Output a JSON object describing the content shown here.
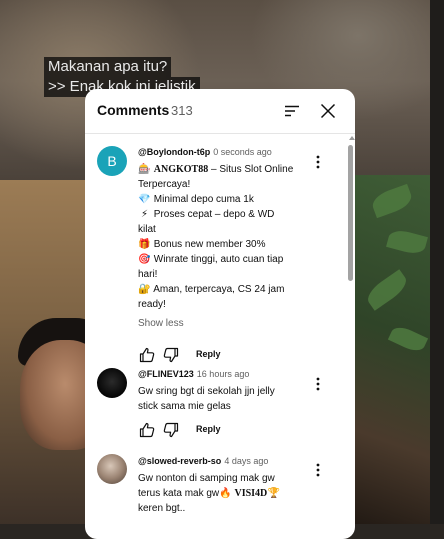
{
  "captions": [
    "Makanan apa itu?",
    ">> Enak kok ini jelistik"
  ],
  "panel": {
    "title": "Comments",
    "count": "313",
    "sort_icon": "sort-icon",
    "close_icon": "close-icon"
  },
  "comments": [
    {
      "handle": "@Boylondon-t6p",
      "time": "0 seconds ago",
      "avatar_letter": "B",
      "avatar_color": "#1aa3b8",
      "lines": [
        {
          "emoji": "🎰",
          "brand": "ANGKOT88",
          "text": " – Situs Slot Online"
        },
        {
          "emoji": "",
          "brand": "",
          "text": "Terpercaya!"
        },
        {
          "emoji": "💎",
          "brand": "",
          "text": " Minimal depo cuma 1k"
        },
        {
          "emoji": "⚡",
          "brand": "",
          "text": " Proses cepat – depo & WD"
        },
        {
          "emoji": "",
          "brand": "",
          "text": "kilat"
        },
        {
          "emoji": "🎁",
          "brand": "",
          "text": " Bonus new member 30%"
        },
        {
          "emoji": "🎯",
          "brand": "",
          "text": " Winrate tinggi, auto cuan tiap"
        },
        {
          "emoji": "",
          "brand": "",
          "text": "hari!"
        },
        {
          "emoji": "🔐",
          "brand": "",
          "text": " Aman, terpercaya, CS 24 jam"
        },
        {
          "emoji": "",
          "brand": "",
          "text": "ready!"
        }
      ],
      "show_less": "Show less",
      "reply": "Reply"
    },
    {
      "handle": "@FLINEV123",
      "time": "16 hours ago",
      "lines": [
        {
          "emoji": "",
          "brand": "",
          "text": "Gw sring bgt di sekolah jjn jelly"
        },
        {
          "emoji": "",
          "brand": "",
          "text": "stick sama mie gelas"
        }
      ],
      "reply": "Reply"
    },
    {
      "handle": "@slowed-reverb-so",
      "time": "4 days ago",
      "lines": [
        {
          "emoji": "",
          "brand": "",
          "text": "Gw nonton di samping mak gw"
        },
        {
          "emoji": "",
          "brand": "",
          "text": "terus kata mak gw",
          "emoji_after": "🔥",
          "brand_after": " VISI4D",
          "emoji_end": "🏆"
        },
        {
          "emoji": "",
          "brand": "",
          "text": "keren bgt.."
        }
      ]
    }
  ],
  "icons": {
    "like": "thumbs-up-icon",
    "dislike": "thumbs-down-icon",
    "more": "more-vertical-icon"
  },
  "colors": {
    "avatar_teal": "#1aa3b8",
    "panel_bg": "#ffffff",
    "text": "#0f0f0f",
    "muted": "#606060"
  }
}
